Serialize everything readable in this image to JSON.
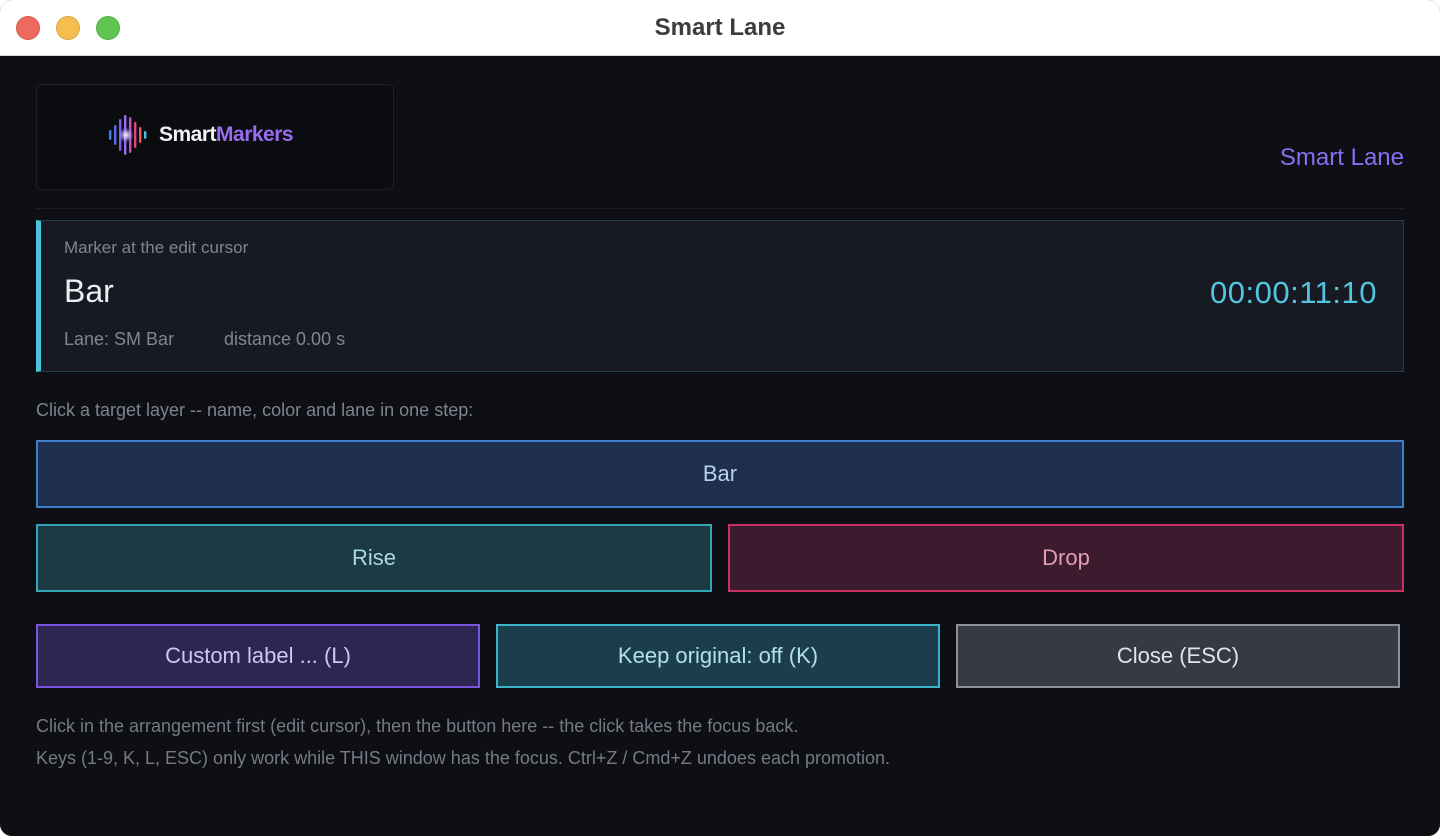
{
  "window": {
    "title": "Smart Lane"
  },
  "header": {
    "logo": {
      "brand_white": "Smart",
      "brand_purple": "Markers",
      "icon": "waveform-icon",
      "colors": [
        "#4a6cf0",
        "#9b6cf0",
        "#e04a7a",
        "#4cc3dc"
      ]
    },
    "app_label": "Smart Lane"
  },
  "marker": {
    "caption": "Marker at the edit cursor",
    "name": "Bar",
    "timecode": "00:00:11:10",
    "lane": "Lane: SM Bar",
    "distance": "distance 0.00 s",
    "accent_color": "#4cc3dc"
  },
  "targets": {
    "instruction": "Click a target layer -- name, color and lane in one step:",
    "buttons": [
      {
        "label": "Bar",
        "color": "#3f80cc"
      },
      {
        "label": "Rise",
        "color": "#35a5b5"
      },
      {
        "label": "Drop",
        "color": "#c8305e"
      }
    ]
  },
  "actions": {
    "custom_label": "Custom label ... (L)",
    "keep_original": "Keep original: off (K)",
    "close": "Close (ESC)"
  },
  "footer": {
    "line1": "Click in the arrangement first (edit cursor), then the button here -- the click takes the focus back.",
    "line2": "Keys (1-9, K, L, ESC) only work while THIS window has the focus. Ctrl+Z / Cmd+Z undoes each promotion."
  }
}
